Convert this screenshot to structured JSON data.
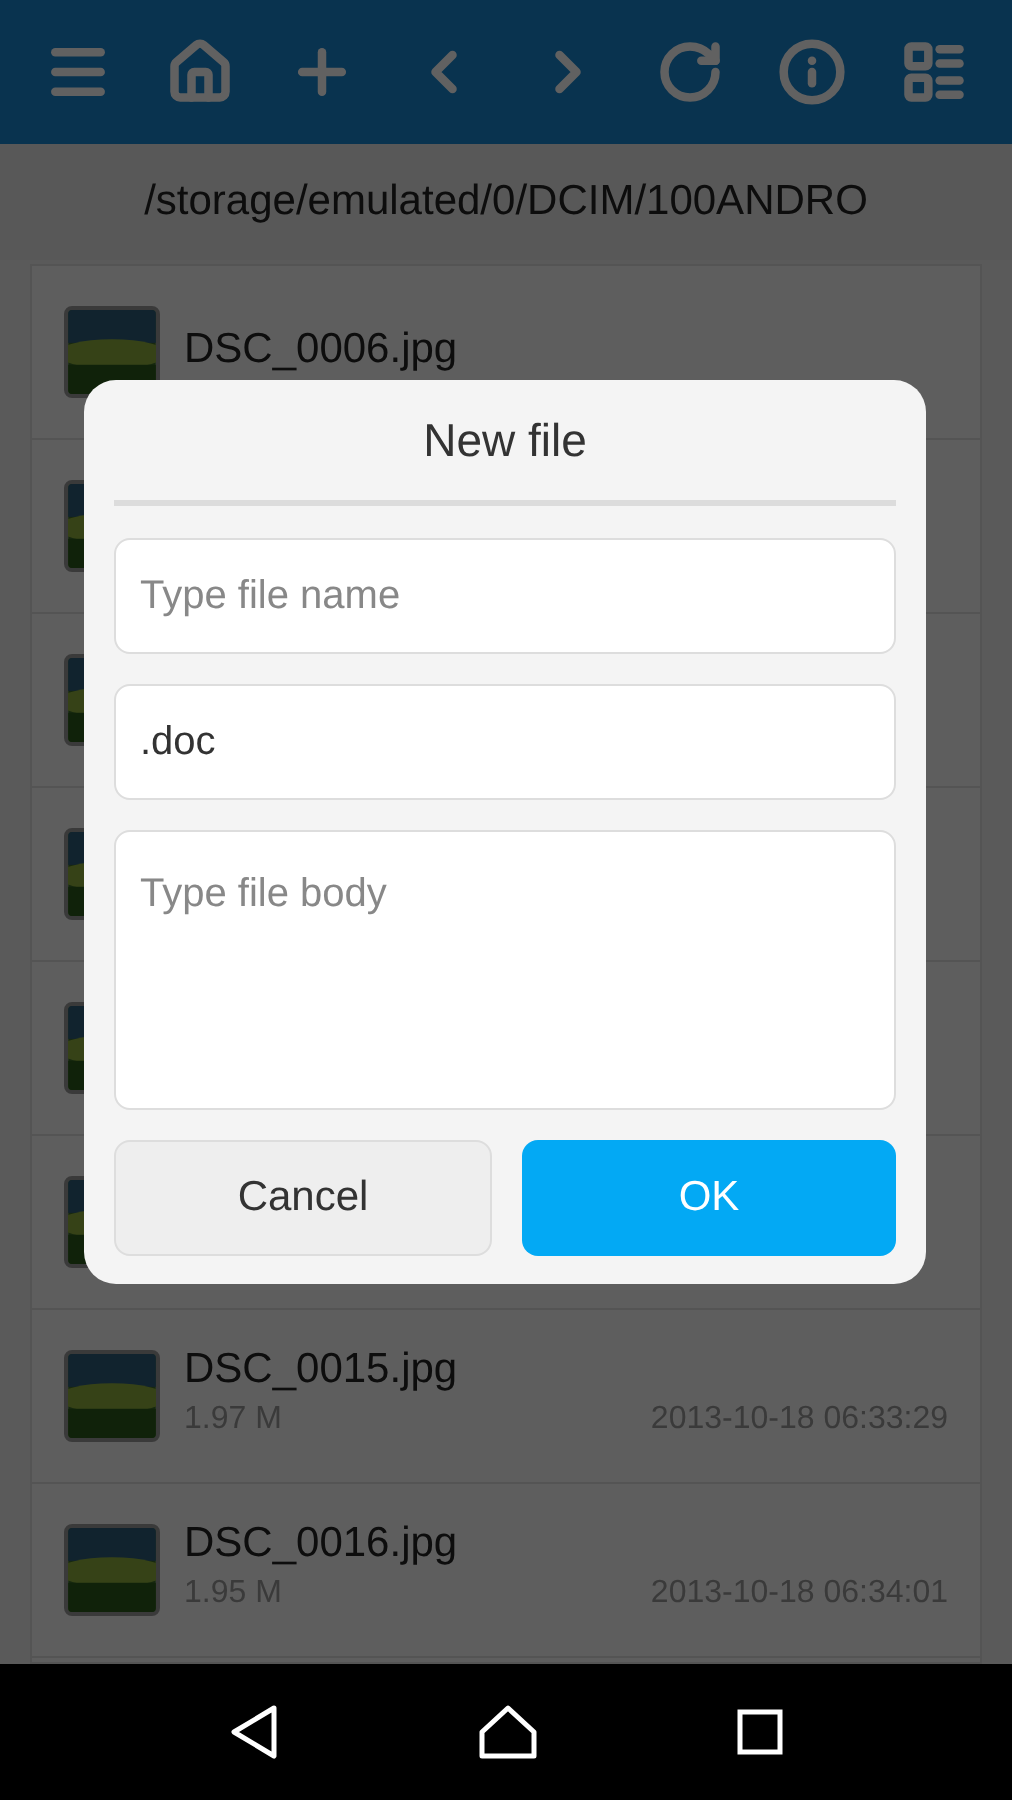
{
  "toolbar": {
    "buttons": [
      {
        "kind": "menu"
      },
      {
        "kind": "home"
      },
      {
        "kind": "add"
      },
      {
        "kind": "back"
      },
      {
        "kind": "forward"
      },
      {
        "kind": "refresh"
      },
      {
        "kind": "info"
      },
      {
        "kind": "view"
      }
    ]
  },
  "path": "/storage/emulated/0/DCIM/100ANDRO",
  "files": [
    {
      "kind": "picture",
      "name": "DSC_0006.jpg"
    },
    {
      "kind": "picture"
    },
    {
      "kind": "picture"
    },
    {
      "kind": "picture"
    },
    {
      "kind": "picture"
    },
    {
      "kind": "picture"
    },
    {
      "kind": "picture",
      "name": "DSC_0015.jpg",
      "size": "1.97 M",
      "date": "2013-10-18 06:33:29"
    },
    {
      "kind": "picture",
      "name": "DSC_0016.jpg",
      "size": "1.95 M",
      "date": "2013-10-18 06:34:01"
    }
  ],
  "dialog": {
    "title": "New file",
    "name_field": {
      "placeholder": "Type file name"
    },
    "extension_field": {
      "value": ".doc"
    },
    "body_field": {
      "placeholder": "Type file body"
    },
    "buttons": [
      {
        "label": "Cancel",
        "kind": "secondary"
      },
      {
        "label": "OK",
        "kind": "primary"
      }
    ]
  },
  "nav_bar": {
    "buttons": [
      {
        "kind": "back"
      },
      {
        "kind": "home"
      },
      {
        "kind": "recents"
      }
    ]
  }
}
